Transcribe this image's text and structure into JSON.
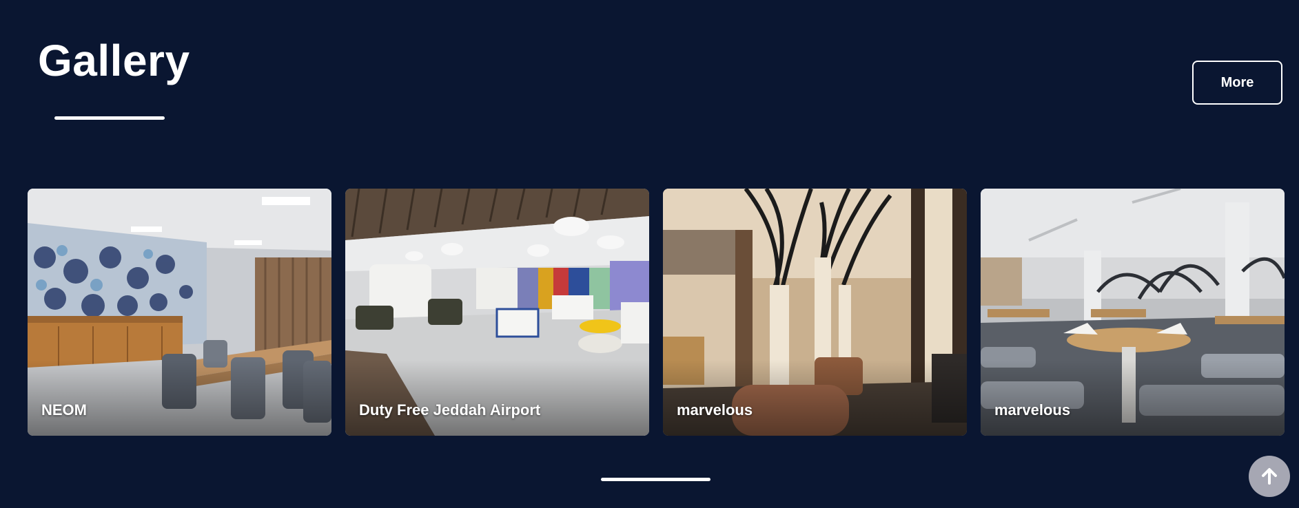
{
  "gallery": {
    "title": "Gallery",
    "more_label": "More"
  },
  "cards": [
    {
      "label": "NEOM"
    },
    {
      "label": "Duty Free Jeddah Airport"
    },
    {
      "label": "marvelous"
    },
    {
      "label": "marvelous"
    }
  ],
  "icons": {
    "scroll_top": "arrow-up-icon"
  },
  "colors": {
    "background": "#0a1631",
    "accent": "#ffffff",
    "scroll_button": "#a6a7b3"
  }
}
